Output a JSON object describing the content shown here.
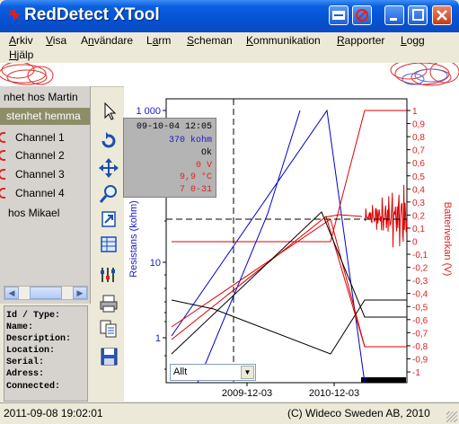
{
  "window": {
    "title": "RedDetect XTool"
  },
  "menu": [
    "Arkiv",
    "Visa",
    "Användare",
    "Larm",
    "Scheman",
    "Kommunikation",
    "Rapporter",
    "Logg",
    "Hjälp"
  ],
  "menu_underline": [
    "A",
    "V",
    "n",
    "a",
    "S",
    "K",
    "R",
    "L",
    "H"
  ],
  "tree": [
    {
      "label": "nhet hos Martin"
    },
    {
      "label": "stenhet hemma"
    },
    {
      "label": "Channel 1"
    },
    {
      "label": "Channel 2"
    },
    {
      "label": "Channel 3"
    },
    {
      "label": "Channel 4"
    },
    {
      "label": "hos Mikael"
    }
  ],
  "info_fields": [
    "Id / Type:",
    "Name:",
    "Description:",
    "Location:",
    "Serial:",
    "Adress:",
    "Connected:"
  ],
  "toolbar_icons": [
    "pointer-icon",
    "refresh-icon",
    "move-icon",
    "zoom-icon",
    "export-icon",
    "table-icon",
    "settings-icon",
    "print-icon",
    "copy-icon",
    "save-icon"
  ],
  "tooltip": {
    "datetime": "09-10-04 12:05",
    "resistance": "370 kohm",
    "status": "Ok",
    "voltage": "0 V",
    "temp": "9,9 °C",
    "code": "7 0-31"
  },
  "select": {
    "value": "Allt"
  },
  "status": {
    "datetime": "2011-09-08 19:02:01",
    "copyright": "(C) Wideco Sweden AB, 2010"
  },
  "chart_data": {
    "type": "line",
    "title": "",
    "ylabel_left": "Resistans (kohm)",
    "ylabel_right": "Batteriverkan (V)",
    "y_left_ticks": [
      "1 000",
      "10",
      "1"
    ],
    "y_left_scale": "log",
    "y_right_ticks": [
      "1",
      "0,9",
      "0,8",
      "0,7",
      "0,6",
      "0,5",
      "0,4",
      "0,3",
      "0,2",
      "0,1",
      "0",
      "-0,1",
      "-0,2",
      "-0,3",
      "-0,4",
      "-0,5",
      "-0,6",
      "-0,7",
      "-0,8",
      "-0,9",
      "-1"
    ],
    "y_right_range": [
      -1,
      1
    ],
    "x_ticks": [
      "2009-12-03",
      "2010-12-03"
    ],
    "crosshair": {
      "x": "2009-10-04",
      "y_right": 0.28
    },
    "series": [],
    "colors": {
      "resistance": "#0000cc",
      "voltage": "#dd0000",
      "other": "#000000"
    }
  }
}
